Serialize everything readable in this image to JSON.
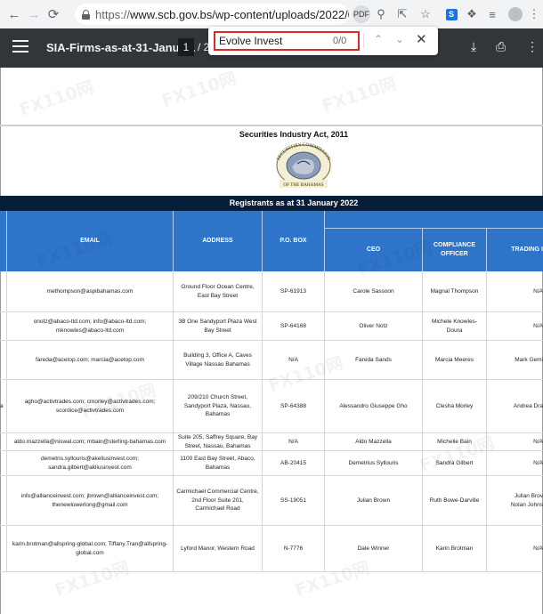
{
  "browser": {
    "url_scheme": "https://",
    "url_rest": "www.scb.gov.bs/wp-content/uploads/2022/02...",
    "pdf_badge": "PDF",
    "icons": [
      "back-icon",
      "forward-icon",
      "reload-icon",
      "lock-icon",
      "zoom-icon",
      "share-icon",
      "star-icon",
      "extension-icon",
      "puzzle-icon",
      "media-icon",
      "profile-icon",
      "menu-icon"
    ]
  },
  "pdf_toolbar": {
    "title": "SIA-Firms-as-at-31-Janua...",
    "page_current": "1",
    "page_separator": "/ 2"
  },
  "find": {
    "query": "Evolve Invest",
    "count": "0/0"
  },
  "document": {
    "act_title": "Securities Industry Act, 2011",
    "seal_top_text": "SECURITIES COMMISSION",
    "seal_bottom_text": "OF THE BAHAMAS",
    "banner": "Registrants as at 31 January 2022",
    "watermark": "FX110网",
    "headers": {
      "email": "EMAIL",
      "address": "ADDRESS",
      "po_box": "P.O. BOX",
      "ceo": "CEO",
      "compliance": "COMPLIANCE OFFICER",
      "trading": "TRADING I"
    },
    "rows": [
      {
        "lead": "",
        "email": "methompson@aspibahamas.com",
        "address": "Ground Floor  Ocean Centre, East Bay Street",
        "po": "SP-61913",
        "ceo": "Carole Sassoon",
        "compliance": "Magnal Thompson",
        "trading": "N/A"
      },
      {
        "lead": "",
        "email": "onotz@abaco-ltd.com; info@abaco-ltd.com; mknowles@abaco-ltd.com",
        "address": "3B One Sandyport Plaza  West Bay Street",
        "po": "SP-64168",
        "ceo": "Oliver Notz",
        "compliance": "Michele Knowles-Doura",
        "trading": "N/A"
      },
      {
        "lead": "",
        "email": "fareda@acetop.com; marcia@acetop.com",
        "address": "Building 3, Office A, Caves Village Nassau Bahamas",
        "po": "N/A",
        "ceo": "Fareda Sands",
        "compliance": "Marcia Meeres",
        "trading": "Mark Gemi"
      },
      {
        "lead": "a",
        "email": "agho@activtrades.com; cmorley@activtrades.com; scordice@activtrades.com",
        "address": "209/210 Church Street, Sandyport Plaza, Nassau, Bahamas",
        "po": "SP-64388",
        "ceo": "Alessandro Giuseppe Gho",
        "compliance": "Clesha Morley",
        "trading": "Andrea Dra"
      },
      {
        "lead": "",
        "email": "aldo.mazzella@niswal.com; mbain@sterling-bahamas.com",
        "address": "Suite 205, Saffrey Square, Bay Street, Nassau, Bahamas",
        "po": "N/A",
        "ceo": "Aldo Mazzella",
        "compliance": "Michelle Bain",
        "trading": "N/A"
      },
      {
        "lead": "",
        "email": "demetris.syllouris@akeliusinvest.com; sandra.gilbert@akliusinvest.com",
        "address": "1100 East Bay Street, Abaco, Bahamas",
        "po": "AB-20415",
        "ceo": "Demetrius Syllouris",
        "compliance": "Sandra Gilbert",
        "trading": "N/A"
      },
      {
        "lead": "",
        "email": "info@allianceinvest.com; jbrown@allianceinvest.com; thenewlowerlong@gmail.com",
        "address": "Carmichael Commercial Centre, 2nd Floor Suite 201, Carmichael Road",
        "po": "SS-19051",
        "ceo": "Julian Brown",
        "compliance": "Ruth Bowe-Darville",
        "trading": "Julian Brov Nolan Johns"
      },
      {
        "lead": "",
        "email": "karin.brotman@allspring-global.com; Tiffany.Tran@allspring-global.com",
        "address": "Lyford Manor, Western Road",
        "po": "N-7776",
        "ceo": "Dale Winner",
        "compliance": "Karin Brotman",
        "trading": "N/A"
      }
    ]
  },
  "colors": {
    "header_blue": "#2e75c9",
    "banner_navy": "#061d3a",
    "toolbar_dark": "#323639",
    "find_highlight": "#e02828"
  }
}
